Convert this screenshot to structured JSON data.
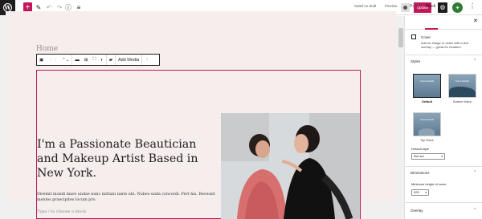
{
  "topbar": {
    "add_label": "+",
    "tools_label": "✎",
    "undo_label": "↶",
    "redo_label": "↷",
    "info_label": "ⓘ",
    "list_view_label": "≡",
    "save_draft_label": "Switch to draft",
    "preview_label": "Preview",
    "update_label": "Update",
    "settings_label": "⚙",
    "more_label": "⋮"
  },
  "editor": {
    "page_title": "Home",
    "block_toolbar": {
      "add_media_label": "Add Media"
    },
    "cover": {
      "heading": "I'm a Passionate Beautician and Makeup Artist Based in New York.",
      "body": "Diremit mondi mare undae nunc mittam tanto ubi. Nubes unda concordi. Fert his. Recessit mentes praecipites locum pro.",
      "placeholder": "Type / to choose a block"
    }
  },
  "sidebar": {
    "tab_page": "Page",
    "tab_block": "Block",
    "close_label": "✕",
    "block_name": "Cover",
    "block_description": "Add an image or video with a text overlay — great for headers.",
    "styles_title": "Styles",
    "styles": [
      {
        "name": "Default",
        "thumb_text": "Some Default"
      },
      {
        "name": "Bottom Wave",
        "thumb_text": "Some Default"
      },
      {
        "name": "Top Wave",
        "thumb_text": "Some Default"
      }
    ],
    "default_style_label": "Default style",
    "default_style_value": "Not set",
    "dimensions_title": "Dimensions",
    "min_height_label": "Minimum height of cover",
    "min_height_value": "525",
    "overlay_title": "Overlay"
  },
  "colors": {
    "accent": "#c2185b",
    "canvas_bg": "#f6eded",
    "dark": "#1e1e1e"
  }
}
